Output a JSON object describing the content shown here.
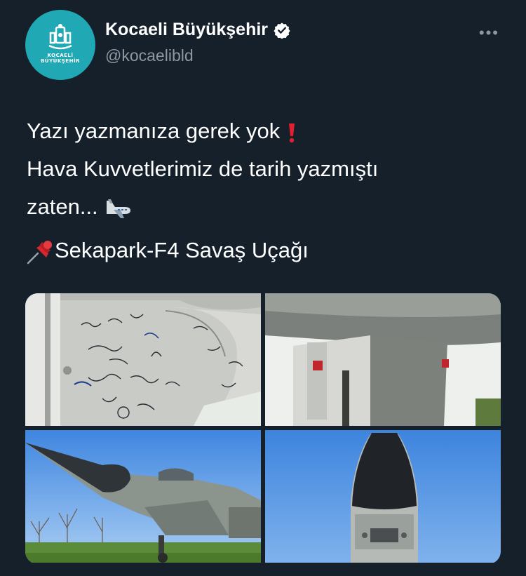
{
  "account": {
    "display_name": "Kocaeli Büyükşehir",
    "handle": "@kocaelibld",
    "avatar_text_line1": "KOCAELİ",
    "avatar_text_line2": "BÜYÜKŞEHİR",
    "verified_icon": "verified-badge-icon",
    "more_icon": "more-options-icon"
  },
  "tweet": {
    "line1": "Yazı yazmanıza gerek yok",
    "line2": "Hava Kuvvetlerimiz de tarih yazmıştı",
    "line3": "zaten...",
    "tag_line": "Sekapark-F4 Savaş Uçağı",
    "emoji_exclamation": "exclamation-mark-icon",
    "emoji_airplane": "airplane-departure-icon",
    "emoji_pin": "pushpin-icon"
  },
  "photos": [
    {
      "name": "photo-graffiti-fuselage"
    },
    {
      "name": "photo-landing-gear"
    },
    {
      "name": "photo-jet-side-view"
    },
    {
      "name": "photo-jet-nose-front"
    }
  ],
  "colors": {
    "background": "#15202b",
    "text": "#ffffff",
    "secondary_text": "#8b98a5",
    "avatar": "#20a9b4",
    "verified": "#ffffff"
  }
}
